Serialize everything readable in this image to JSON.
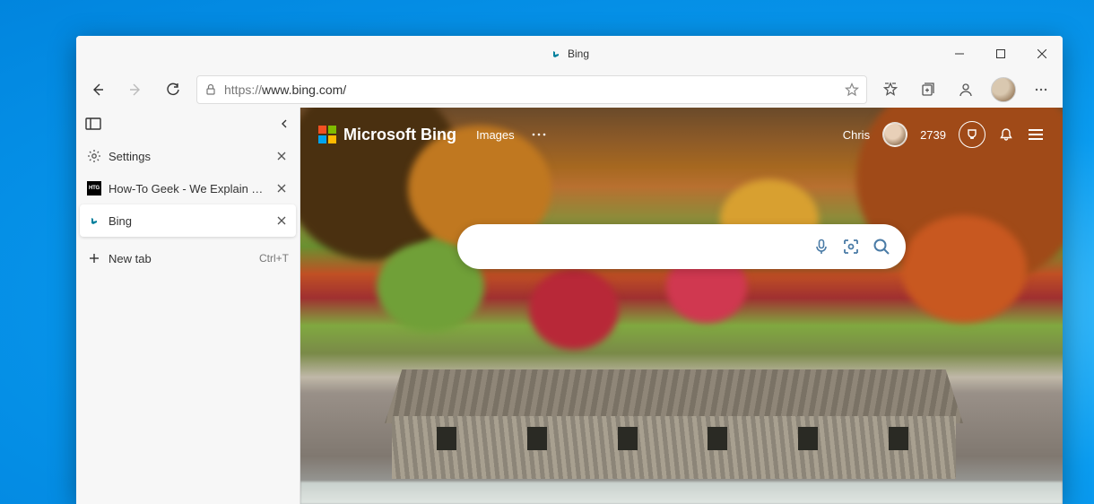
{
  "window": {
    "title": "Bing"
  },
  "toolbar": {
    "url_protocol": "https://",
    "url_rest": "www.bing.com/"
  },
  "vtabs": {
    "items": [
      {
        "label": "Settings",
        "closable": true,
        "favicon": "gear"
      },
      {
        "label": "How-To Geek - We Explain Techn",
        "closable": true,
        "favicon": "htg"
      },
      {
        "label": "Bing",
        "closable": true,
        "favicon": "bing",
        "active": true
      }
    ],
    "new_tab_label": "New tab",
    "new_tab_shortcut": "Ctrl+T"
  },
  "bing": {
    "brand": "Microsoft Bing",
    "nav_images": "Images",
    "user_name": "Chris",
    "points": "2739",
    "search_placeholder": ""
  }
}
